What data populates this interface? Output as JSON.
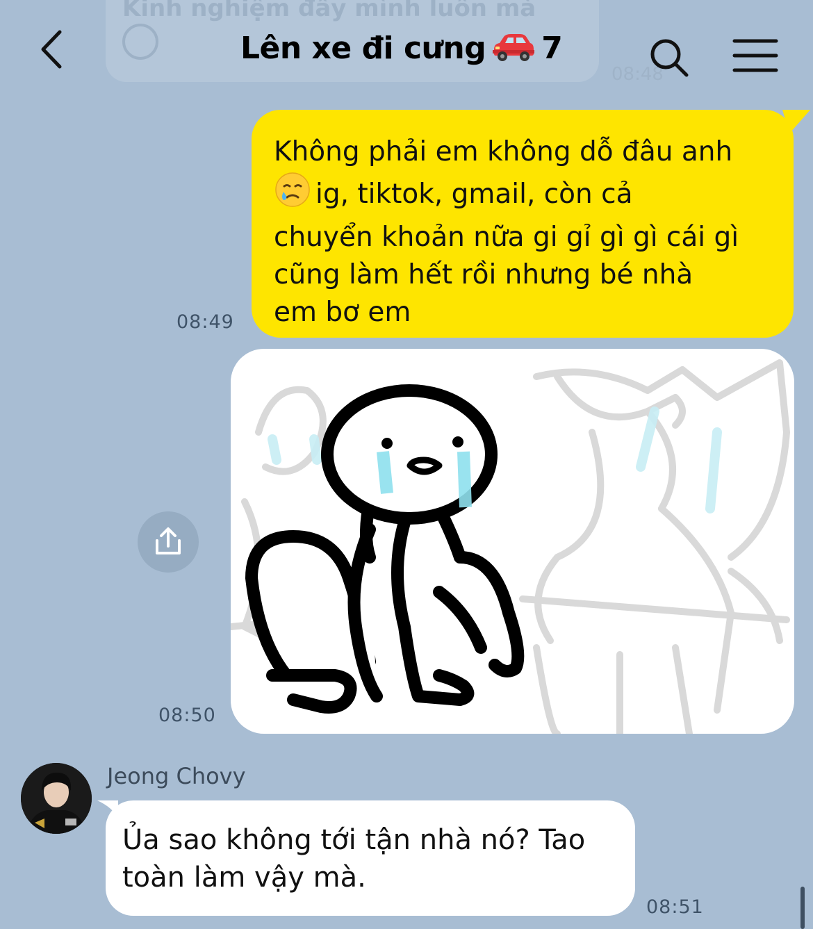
{
  "header": {
    "title": "Lên xe đi cưng",
    "member_count": "7",
    "icons": {
      "back": "chevron-left-icon",
      "search": "search-icon",
      "menu": "hamburger-menu-icon",
      "title_emoji": "red-car-emoji"
    }
  },
  "previous_message": {
    "text": "Kinh nghiệm đầy mình luôn mà",
    "time": "08:48"
  },
  "messages": [
    {
      "sender": "me",
      "text_lines": [
        "Không phải em không dỗ đâu anh",
        "ig, tiktok, gmail, còn cả",
        "chuyển khoản nữa gi gỉ gì gì cái gì",
        "cũng làm hết rồi nhưng bé nhà",
        "em bơ em"
      ],
      "inline_emoji": "crying-face-emoji",
      "time": "08:49"
    },
    {
      "sender": "me",
      "type": "sticker",
      "sticker": "crying-stick-figure-sticker",
      "time": "08:50"
    },
    {
      "sender": "Jeong Chovy",
      "text_lines": [
        "Ủa sao không tới tận nhà nó? Tao",
        "toàn làm vậy mà."
      ],
      "time": "08:51"
    }
  ],
  "colors": {
    "background": "#a8bdd3",
    "my_bubble": "#fee500",
    "their_bubble": "#ffffff",
    "tear": "#8fe0ee"
  }
}
